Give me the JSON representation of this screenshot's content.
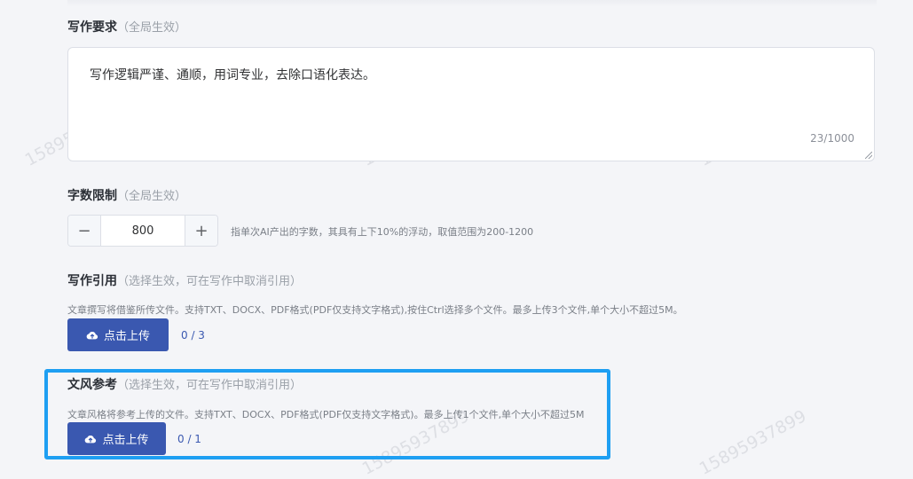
{
  "writing_requirements": {
    "title": "写作要求",
    "hint": "（全局生效）",
    "text": "写作逻辑严谨、通顺，用词专业，去除口语化表达。",
    "char_count": "23/1000"
  },
  "word_limit": {
    "title": "字数限制",
    "hint": "（全局生效）",
    "minus_symbol": "−",
    "value": "800",
    "plus_symbol": "+",
    "description": "指单次AI产出的字数，其具有上下10%的浮动，取值范围为200-1200"
  },
  "writing_reference": {
    "title": "写作引用",
    "hint": "（选择生效，可在写作中取消引用）",
    "description": "文章撰写将借鉴所传文件。支持TXT、DOCX、PDF格式(PDF仅支持文字格式),按住Ctrl选择多个文件。最多上传3个文件,单个大小不超过5M。",
    "upload_label": "点击上传",
    "file_count": "0 / 3"
  },
  "style_reference": {
    "title": "文风参考",
    "hint": "（选择生效，可在写作中取消引用）",
    "description": "文章风格将参考上传的文件。支持TXT、DOCX、PDF格式(PDF仅支持文字格式)。最多上传1个文件,单个大小不超过5M",
    "upload_label": "点击上传",
    "file_count": "0 / 1"
  },
  "watermark": "15895937899",
  "colors": {
    "primary": "#3a58b0",
    "highlight": "#1e9ff2",
    "background": "#f4f5f8"
  },
  "icons": {
    "upload": "cloud-upload-icon"
  }
}
